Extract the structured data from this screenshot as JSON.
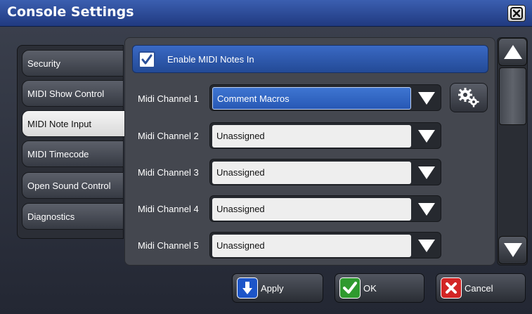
{
  "window": {
    "title": "Console Settings"
  },
  "tabs": [
    {
      "label": "Security"
    },
    {
      "label": "MIDI Show Control"
    },
    {
      "label": "MIDI Note Input"
    },
    {
      "label": "MIDI Timecode"
    },
    {
      "label": "Open Sound Control"
    },
    {
      "label": "Diagnostics"
    }
  ],
  "active_tab": "MIDI Note Input",
  "enable": {
    "label": "Enable MIDI Notes In",
    "checked": true
  },
  "channels": [
    {
      "label": "Midi Channel 1",
      "value": "Comment Macros"
    },
    {
      "label": "Midi Channel 2",
      "value": "Unassigned"
    },
    {
      "label": "Midi Channel 3",
      "value": "Unassigned"
    },
    {
      "label": "Midi Channel 4",
      "value": "Unassigned"
    },
    {
      "label": "Midi Channel 5",
      "value": "Unassigned"
    }
  ],
  "buttons": {
    "apply": "Apply",
    "ok": "OK",
    "cancel": "Cancel"
  },
  "icons": {
    "close": "close-icon",
    "checkmark": "checkmark-icon",
    "dropdown": "chevron-down-icon",
    "settings": "gears-icon",
    "scroll_up": "arrow-up-icon",
    "scroll_down": "arrow-down-icon"
  },
  "colors": {
    "accent": "#2d5bb5",
    "apply": "#1d55c8",
    "ok": "#2f9a2f",
    "cancel": "#d32525"
  }
}
